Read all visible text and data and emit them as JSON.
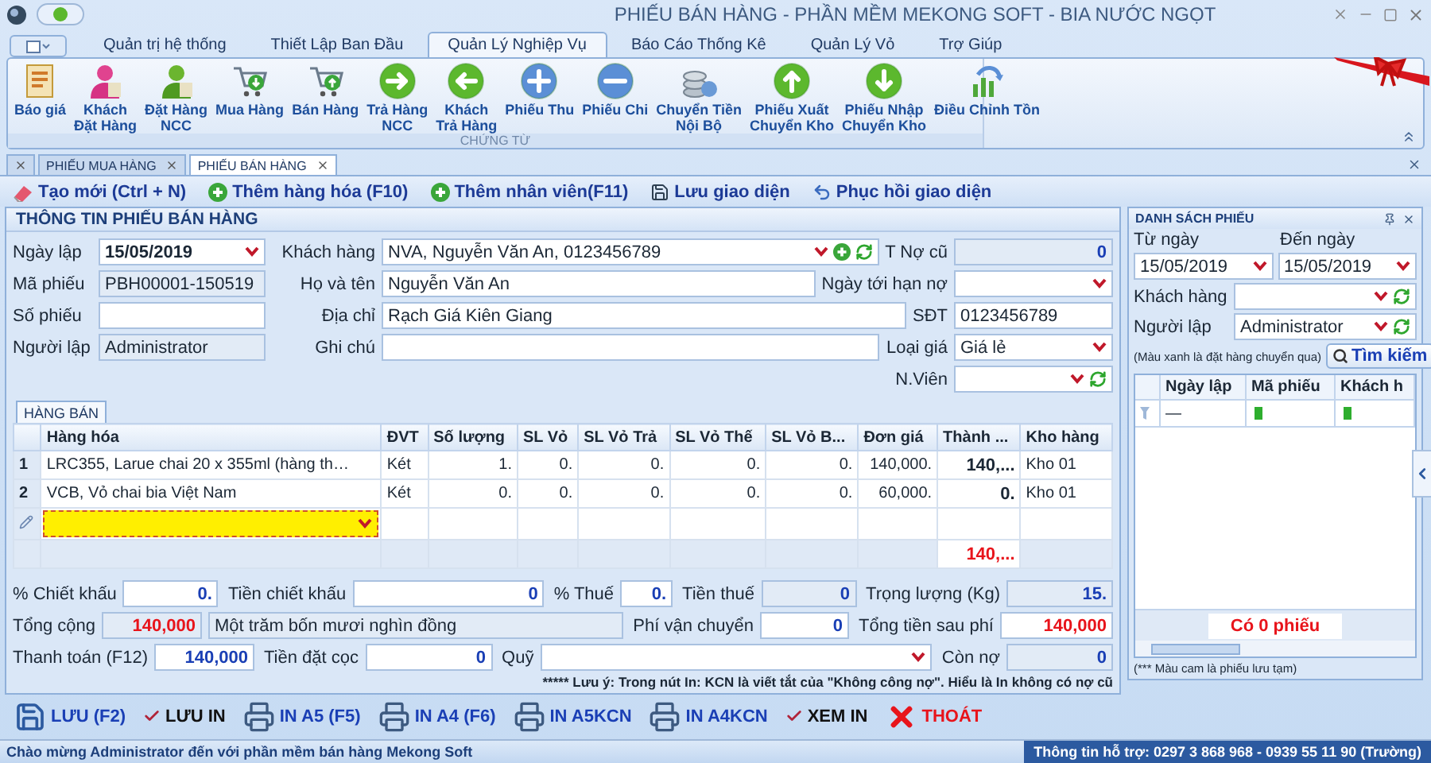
{
  "window": {
    "title": "PHIẾU BÁN HÀNG - PHẦN MỀM MEKONG SOFT - BIA NƯỚC NGỌT"
  },
  "ribbon": {
    "tabs": [
      {
        "label": "Quản trị hệ thống",
        "selected": false
      },
      {
        "label": "Thiết Lập Ban Đầu",
        "selected": false
      },
      {
        "label": "Quản Lý Nghiệp Vụ",
        "selected": true
      },
      {
        "label": "Báo Cáo Thống Kê",
        "selected": false
      },
      {
        "label": "Quản Lý Vỏ",
        "selected": false
      },
      {
        "label": "Trợ Giúp",
        "selected": false
      }
    ],
    "buttons": [
      {
        "label": "Báo giá"
      },
      {
        "label": "Khách\nĐặt Hàng"
      },
      {
        "label": "Đặt Hàng\nNCC"
      },
      {
        "label": "Mua Hàng"
      },
      {
        "label": "Bán Hàng"
      },
      {
        "label": "Trả Hàng\nNCC"
      },
      {
        "label": "Khách\nTrả Hàng"
      },
      {
        "label": "Phiếu Thu"
      },
      {
        "label": "Phiếu Chi"
      },
      {
        "label": "Chuyển Tiền\nNội Bộ"
      },
      {
        "label": "Phiếu Xuất\nChuyển Kho"
      },
      {
        "label": "Phiếu Nhập\nChuyển Kho"
      },
      {
        "label": "Điều Chỉnh Tồn"
      }
    ],
    "group": "CHỨNG TỪ"
  },
  "documents": {
    "tabs": [
      {
        "label": "PHIẾU MUA HÀNG",
        "selected": false
      },
      {
        "label": "PHIẾU BÁN HÀNG",
        "selected": true
      }
    ]
  },
  "toolbar": [
    {
      "label": "Tạo mới (Ctrl + N)"
    },
    {
      "label": "Thêm hàng hóa (F10)"
    },
    {
      "label": "Thêm nhân viên(F11)"
    },
    {
      "label": "Lưu giao diện"
    },
    {
      "label": "Phục hồi giao diện"
    }
  ],
  "form": {
    "title": "THÔNG TIN PHIẾU BÁN HÀNG",
    "rows": [
      [
        {
          "label": "Ngày lập",
          "value": "15/05/2019",
          "kind": "date",
          "readonly": false
        },
        {
          "label": "Khách hàng",
          "value": "NVA, Nguyễn Văn An, 0123456789",
          "kind": "lookup",
          "readonly": false
        },
        {
          "label": "T Nợ cũ",
          "value": "0",
          "kind": "number",
          "readonly": true
        }
      ],
      [
        {
          "label": "Mã phiếu",
          "value": "PBH00001-150519",
          "kind": "text",
          "readonly": true
        },
        {
          "label": "Họ và tên",
          "value": "Nguyễn Văn An",
          "kind": "text",
          "readonly": false
        },
        {
          "label": "Ngày tới hạn nợ",
          "kind": "dropdown",
          "readonly": false
        }
      ],
      [
        {
          "label": "Số phiếu",
          "kind": "text",
          "readonly": false
        },
        {
          "label": "Địa chỉ",
          "value": "Rạch Giá Kiên Giang",
          "kind": "text",
          "readonly": false
        },
        {
          "label": "SĐT",
          "value": "0123456789",
          "kind": "text",
          "readonly": false
        }
      ],
      [
        {
          "label": "Người lập",
          "value": "Administrator",
          "kind": "text",
          "readonly": true
        },
        {
          "label": "Ghi chú",
          "kind": "text",
          "readonly": false
        },
        {
          "label": "Loại giá",
          "value": "Giá lẻ",
          "kind": "dropdown",
          "readonly": false
        }
      ]
    ],
    "staff": {
      "label": "N.Viên",
      "kind": "picker",
      "readonly": false
    }
  },
  "grid": {
    "tab": "HÀNG BÁN",
    "columns": [
      "Hàng hóa",
      "ĐVT",
      "Số lượng",
      "SL Vỏ",
      "SL Vỏ Trả",
      "SL Vỏ Thế",
      "SL Vỏ B...",
      "Đơn giá",
      "Thành ...",
      "Kho hàng"
    ],
    "rows": [
      {
        "number": "1",
        "cells": [
          "LRC355, Larue chai 20 x 355ml (hàng th…",
          "Két",
          "1.",
          "0.",
          "0.",
          "0.",
          "0.",
          "140,000.",
          "140,...",
          "Kho 01"
        ]
      },
      {
        "number": "2",
        "cells": [
          "VCB, Vỏ chai bia Việt Nam",
          "Két",
          "0.",
          "0.",
          "0.",
          "0.",
          "0.",
          "60,000.",
          "0.",
          "Kho 01"
        ]
      }
    ],
    "new_row": {
      "editing": true
    },
    "footer_total": "140,..."
  },
  "totals": {
    "rows": [
      [
        {
          "label": "% Chiết khấu",
          "value": "0.",
          "kind": "number",
          "readonly": false
        },
        {
          "label": "Tiền chiết khấu",
          "value": "0",
          "kind": "number",
          "readonly": false
        },
        {
          "label": "% Thuế",
          "value": "0.",
          "kind": "number",
          "readonly": false
        },
        {
          "label": "Tiền thuế",
          "value": "0",
          "kind": "number",
          "readonly": true
        },
        {
          "label": "Trọng lượng (Kg)",
          "value": "15.",
          "kind": "number",
          "readonly": true
        }
      ],
      [
        {
          "label": "Tổng cộng",
          "value": "140,000",
          "kind": "total",
          "readonly": true
        },
        {
          "value": "Một trăm bốn mươi nghìn đồng",
          "kind": "text",
          "readonly": true
        },
        {
          "label": "Phí vận chuyển",
          "value": "0",
          "kind": "number",
          "readonly": false
        },
        {
          "label": "Tổng tiền sau phí",
          "value": "140,000",
          "kind": "total",
          "readonly": false
        }
      ],
      [
        {
          "label": "Thanh toán (F12)",
          "value": "140,000",
          "kind": "number",
          "readonly": false
        },
        {
          "label": "Tiền đặt cọc",
          "value": "0",
          "kind": "number",
          "readonly": false
        },
        {
          "label": "Quỹ",
          "kind": "dropdown",
          "readonly": false
        },
        {
          "label": "Còn nợ",
          "value": "0",
          "kind": "number",
          "readonly": true
        }
      ]
    ],
    "note": "***** Lưu ý: Trong nút In: KCN là viết tắt của \"Không công nợ\". Hiểu là In không có nợ cũ"
  },
  "actions": [
    {
      "label": "LƯU (F2)",
      "kind": "action"
    },
    {
      "label": "LƯU IN",
      "kind": "plain"
    },
    {
      "label": "IN A5 (F5)",
      "kind": "action"
    },
    {
      "label": "IN A4 (F6)",
      "kind": "action"
    },
    {
      "label": "IN A5KCN",
      "kind": "action"
    },
    {
      "label": "IN A4KCN",
      "kind": "action"
    },
    {
      "label": "XEM IN",
      "kind": "plain"
    },
    {
      "label": "THOÁT",
      "kind": "exit"
    }
  ],
  "list_panel": {
    "title": "DANH SÁCH PHIẾU",
    "from_label": "Từ ngày",
    "from": "15/05/2019",
    "to_label": "Đến ngày",
    "to": "15/05/2019",
    "customer_label": "Khách hàng",
    "creator_label": "Người lập",
    "creator": "Administrator",
    "hint": "(Màu xanh là đặt hàng chuyển qua)",
    "search_button": "Tìm kiếm",
    "columns": [
      "Ngày lập",
      "Mã phiếu",
      "Khách h"
    ],
    "filter_value": "—",
    "count": "Có 0 phiếu",
    "footnote": "(*** Màu cam là phiếu lưu tạm)"
  },
  "status_bar": {
    "message": "Chào mừng Administrator đến với phần mềm bán hàng Mekong Soft",
    "support": "Thông tin hỗ trợ: 0297 3 868 968 - 0939 55 11 90 (Trường)"
  }
}
